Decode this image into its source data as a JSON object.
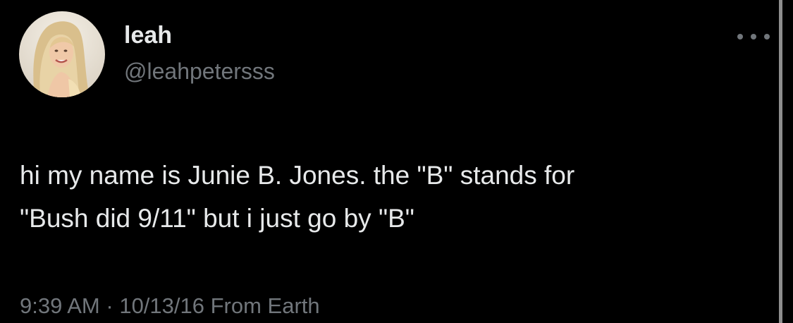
{
  "tweet": {
    "author": {
      "name": "leah",
      "handle": "@leahpetersss"
    },
    "text_lines": [
      "hi my name is Junie B. Jones. the \"B\" stands for",
      "\"Bush did 9/11\" but i just go by \"B\""
    ],
    "meta": {
      "time": "9:39 AM",
      "separator": "·",
      "date": "10/13/16",
      "source": "From Earth"
    }
  },
  "icons": {
    "more": "more-options-icon"
  },
  "colors": {
    "background": "#000000",
    "primary_text": "#e7e9ea",
    "secondary_text": "#71767b",
    "scrollbar": "#8e8e8e"
  }
}
